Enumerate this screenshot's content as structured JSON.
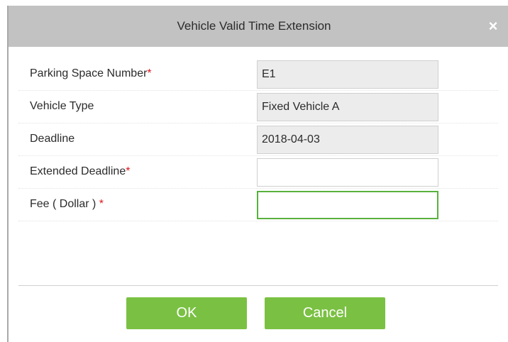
{
  "dialog": {
    "title": "Vehicle Valid Time Extension",
    "close_glyph": "×",
    "close_icon": "close-icon"
  },
  "form": {
    "fields": [
      {
        "label": "Parking Space Number",
        "required_mark": "*",
        "value": "E1",
        "readonly": true
      },
      {
        "label": "Vehicle Type",
        "required_mark": "",
        "value": "Fixed Vehicle A",
        "readonly": true
      },
      {
        "label": "Deadline",
        "required_mark": "",
        "value": "2018-04-03",
        "readonly": true
      },
      {
        "label": "Extended Deadline",
        "required_mark": "*",
        "value": "",
        "readonly": false
      },
      {
        "label": "Fee ( Dollar ) ",
        "required_mark": "*",
        "value": "",
        "readonly": false,
        "focused": true
      }
    ]
  },
  "buttons": {
    "ok_label": "OK",
    "cancel_label": "Cancel"
  },
  "colors": {
    "titlebar": "#c2c2c2",
    "button": "#7ac143",
    "focus_border": "#58b13d",
    "required": "#e0151b"
  }
}
